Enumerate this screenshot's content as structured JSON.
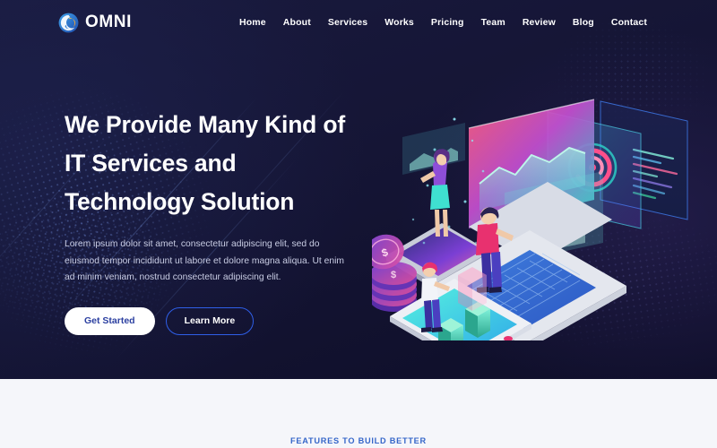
{
  "header": {
    "logo": {
      "icon": "swirl-circle-logo-icon",
      "text": "OMNI"
    },
    "nav": [
      {
        "label": "Home"
      },
      {
        "label": "About"
      },
      {
        "label": "Services"
      },
      {
        "label": "Works"
      },
      {
        "label": "Pricing"
      },
      {
        "label": "Team"
      },
      {
        "label": "Review"
      },
      {
        "label": "Blog"
      },
      {
        "label": "Contact"
      }
    ]
  },
  "hero": {
    "headline_lines": [
      "We Provide Many Kind of",
      "IT Services and",
      "Technology Solution"
    ],
    "paragraph": "Lorem ipsum dolor sit amet, consectetur adipiscing elit, sed do eiusmod tempor incididunt ut labore et dolore magna aliqua. Ut enim ad minim veniam, nostrud consectetur adipiscing elit.",
    "buttons": {
      "primary": "Get Started",
      "secondary": "Learn More"
    },
    "illustration": {
      "name": "isometric-technology-illustration",
      "elements": [
        "laptop",
        "tablet-with-bar-chart",
        "smartphone",
        "coin-stack",
        "floating-dashboard-panels",
        "person-standing-on-laptop",
        "person-on-phone-screen",
        "person-on-tablet"
      ]
    }
  },
  "features": {
    "label": "FEATURES TO BUILD BETTER"
  },
  "colors": {
    "hero_background": "#151535",
    "hero_background_deep": "#0e0e28",
    "nav_text": "#ffffff",
    "headline": "#ffffff",
    "paragraph": "#c9cde4",
    "primary_button_bg": "#ffffff",
    "primary_button_text": "#2b3fa0",
    "outline_button_border": "#2f5fe8",
    "features_background": "#f5f6fa",
    "features_label": "#3566c9",
    "logo_ring": "#2f7fd4",
    "logo_swirl": "#f5a623"
  }
}
